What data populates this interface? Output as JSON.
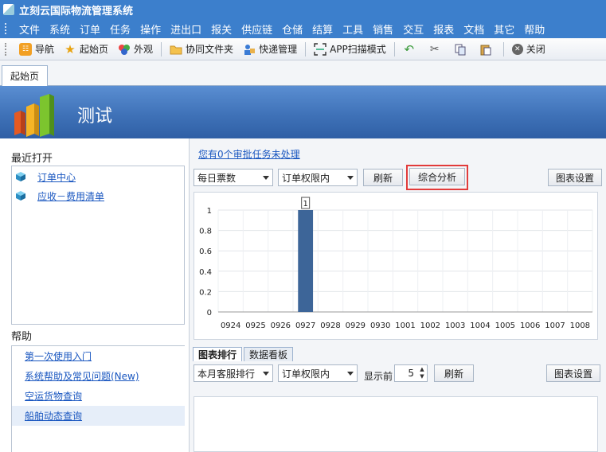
{
  "window": {
    "title": "立刻云国际物流管理系统"
  },
  "menu": [
    "文件",
    "系统",
    "订单",
    "任务",
    "操作",
    "进出口",
    "报关",
    "供应链",
    "仓储",
    "结算",
    "工具",
    "销售",
    "交互",
    "报表",
    "文档",
    "其它",
    "帮助"
  ],
  "toolbar": {
    "items": [
      {
        "label": "导航",
        "icon": "navigation-icon"
      },
      {
        "label": "起始页",
        "icon": "star-icon"
      },
      {
        "label": "外观",
        "icon": "palette-icon"
      },
      {
        "label": "协同文件夹",
        "icon": "folder-icon"
      },
      {
        "label": "快递管理",
        "icon": "courier-icon"
      },
      {
        "label": "APP扫描模式",
        "icon": "scan-icon"
      },
      {
        "label": "",
        "icon": "undo-icon"
      },
      {
        "label": "",
        "icon": "cut-icon"
      },
      {
        "label": "",
        "icon": "copy-icon"
      },
      {
        "label": "",
        "icon": "paste-icon"
      },
      {
        "label": "关闭",
        "icon": "close-icon"
      }
    ]
  },
  "tabs": {
    "start": "起始页"
  },
  "banner": {
    "title": "测试"
  },
  "left": {
    "recent_title": "最近打开",
    "recent": [
      {
        "label": "订单中心    "
      },
      {
        "label": "应收－费用清单"
      }
    ],
    "help_title": "帮助",
    "help": [
      {
        "label": "第一次使用入门"
      },
      {
        "label": "系统帮助及常见问题(New)"
      },
      {
        "label": "空运货物查询"
      },
      {
        "label": "船舶动态查询"
      }
    ]
  },
  "main": {
    "pending": "您有0个审批任务未处理",
    "metric_select": "每日票数",
    "scope_select": "订单权限内",
    "refresh": "刷新",
    "analysis": "综合分析",
    "chart_settings": "图表设置",
    "tabs": [
      "图表排行",
      "数据看板"
    ],
    "rank_select": "本月客服排行",
    "rank_scope_select": "订单权限内",
    "show_top_label": "显示前",
    "show_top_value": "5",
    "refresh2": "刷新",
    "chart_settings2": "图表设置"
  },
  "chart_data": {
    "type": "bar",
    "categories": [
      "0924",
      "0925",
      "0926",
      "0927",
      "0928",
      "0929",
      "0930",
      "1001",
      "1002",
      "1003",
      "1004",
      "1005",
      "1006",
      "1007",
      "1008"
    ],
    "values": [
      0,
      0,
      0,
      1,
      0,
      0,
      0,
      0,
      0,
      0,
      0,
      0,
      0,
      0,
      0
    ],
    "data_labels": [
      "",
      "",
      "",
      "1",
      "",
      "",
      "",
      "",
      "",
      "",
      "",
      "",
      "",
      "",
      ""
    ],
    "yticks": [
      "0",
      "0.2",
      "0.4",
      "0.6",
      "0.8",
      "1"
    ],
    "ylim": [
      0,
      1
    ],
    "grid": true,
    "colors": {
      "bar": "#3d6598"
    }
  }
}
